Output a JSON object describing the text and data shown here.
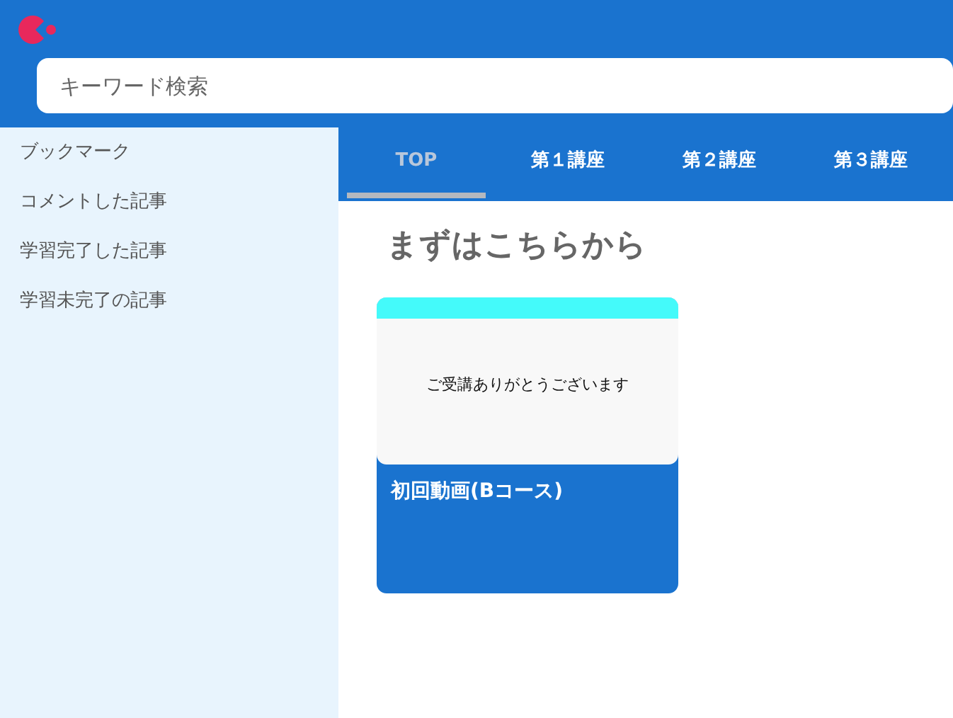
{
  "search": {
    "placeholder": "キーワード検索"
  },
  "sidebar": {
    "items": [
      {
        "label": "ブックマーク"
      },
      {
        "label": "コメントした記事"
      },
      {
        "label": "学習完了した記事"
      },
      {
        "label": "学習未完了の記事"
      }
    ]
  },
  "tabs": [
    {
      "label": "TOP",
      "selected": true
    },
    {
      "label": "第１講座",
      "selected": false
    },
    {
      "label": "第２講座",
      "selected": false
    },
    {
      "label": "第３講座",
      "selected": false
    }
  ],
  "section": {
    "title": "まずはこちらから",
    "cards": [
      {
        "thumbnail_text": "ご受講ありがとうございます",
        "title": "初回動画(Bコース)"
      }
    ]
  }
}
